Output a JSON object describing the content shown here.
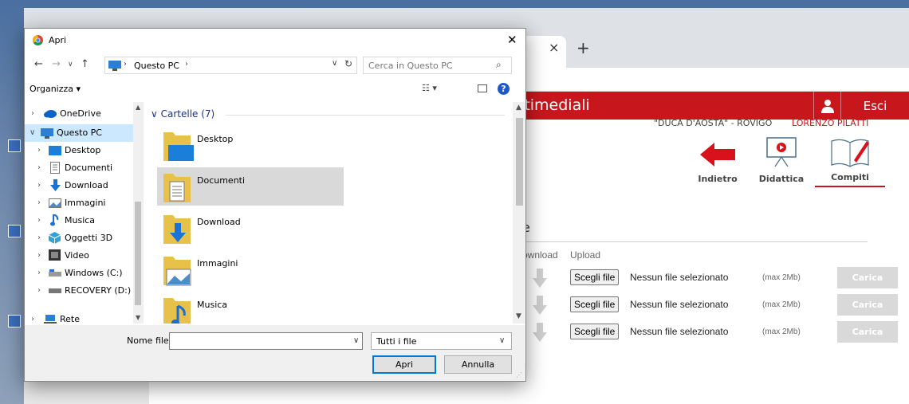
{
  "colors": {
    "brand_red": "#c8161d",
    "selection_blue": "#cce8ff",
    "accent_blue": "#0078d7",
    "link_blue": "#1e3287"
  },
  "browser": {
    "tab_close": "×",
    "new_tab": "+"
  },
  "site": {
    "title": "ultimediali",
    "logout": "Esci",
    "school": "\"DUCA D'AOSTA\" - ROVIGO",
    "user": "LORENZO PILATTI",
    "nav": {
      "back": "Indietro",
      "didactic": "Didattica",
      "tasks": "Compiti"
    },
    "heading_letter": "e",
    "columns": {
      "download": "ownload",
      "upload": "Upload"
    },
    "uploads": [
      {
        "choose": "Scegli file",
        "status": "Nessun file selezionato",
        "max": "(max 2Mb)",
        "action": "Carica"
      },
      {
        "choose": "Scegli file",
        "status": "Nessun file selezionato",
        "max": "(max 2Mb)",
        "action": "Carica"
      },
      {
        "choose": "Scegli file",
        "status": "Nessun file selezionato",
        "max": "(max 2Mb)",
        "action": "Carica"
      }
    ]
  },
  "dialog": {
    "title": "Apri",
    "close": "✕",
    "address": {
      "location": "Questo PC",
      "sep": "›"
    },
    "search": {
      "placeholder": "Cerca in Questo PC"
    },
    "organize": "Organizza ▾",
    "help": "?",
    "nav_tree": [
      {
        "label": "OneDrive",
        "icon": "cloud-icon",
        "expanded": false,
        "selected": false
      },
      {
        "label": "Questo PC",
        "icon": "pc-icon",
        "expanded": true,
        "selected": true
      },
      {
        "label": "Desktop",
        "icon": "desktop-icon",
        "expanded": false,
        "selected": false
      },
      {
        "label": "Documenti",
        "icon": "document-icon",
        "expanded": false,
        "selected": false
      },
      {
        "label": "Download",
        "icon": "download-icon",
        "expanded": false,
        "selected": false
      },
      {
        "label": "Immagini",
        "icon": "images-icon",
        "expanded": false,
        "selected": false
      },
      {
        "label": "Musica",
        "icon": "music-icon",
        "expanded": false,
        "selected": false
      },
      {
        "label": "Oggetti 3D",
        "icon": "cube-icon",
        "expanded": false,
        "selected": false
      },
      {
        "label": "Video",
        "icon": "video-icon",
        "expanded": false,
        "selected": false
      },
      {
        "label": "Windows (C:)",
        "icon": "drive-icon",
        "expanded": false,
        "selected": false
      },
      {
        "label": "RECOVERY (D:)",
        "icon": "drive-icon",
        "expanded": false,
        "selected": false
      },
      {
        "label": "Rete",
        "icon": "network-icon",
        "expanded": false,
        "selected": false
      }
    ],
    "group_header": "Cartelle (7)",
    "folders": [
      {
        "label": "Desktop",
        "selected": false
      },
      {
        "label": "Documenti",
        "selected": true
      },
      {
        "label": "Download",
        "selected": false
      },
      {
        "label": "Immagini",
        "selected": false
      },
      {
        "label": "Musica",
        "selected": false
      }
    ],
    "filename_label": "Nome file:",
    "filename_value": "",
    "filetype": "Tutti i file",
    "open": "Apri",
    "cancel": "Annulla"
  }
}
